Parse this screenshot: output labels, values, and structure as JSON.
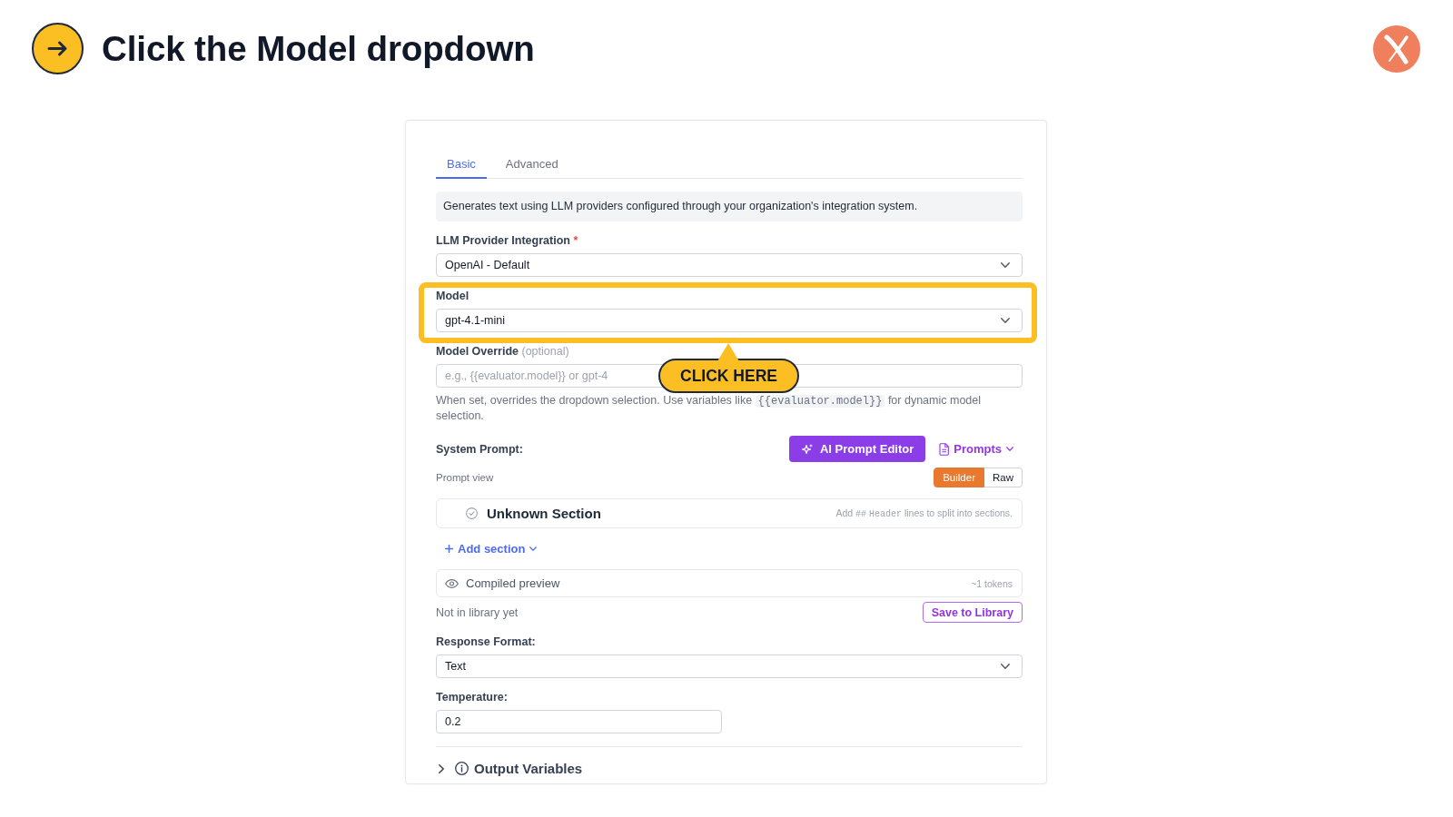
{
  "step": {
    "title": "Click the Model dropdown",
    "callout": "CLICK HERE"
  },
  "panel": {
    "tabs": [
      {
        "label": "Basic",
        "selected": true
      },
      {
        "label": "Advanced",
        "selected": false
      }
    ],
    "description": "Generates text using LLM providers configured through your organization's integration system.",
    "fields": [
      {
        "kind": "select",
        "label": "LLM Provider Integration",
        "required_mark": "*",
        "value": "OpenAI - Default",
        "highlighted": false
      },
      {
        "kind": "select",
        "label": "Model",
        "value": "gpt-4.1-mini",
        "highlighted": true
      },
      {
        "kind": "text",
        "label": "Model Override",
        "note": "(optional)",
        "placeholder": "e.g., {{evaluator.model}} or gpt-4",
        "highlighted": false,
        "help": [
          {
            "kind": "text",
            "text": "When set, overrides the dropdown selection. Use variables like"
          },
          {
            "kind": "code",
            "text": "{{evaluator.model}}"
          },
          {
            "kind": "text",
            "text": "for dynamic model selection."
          }
        ]
      }
    ],
    "system_prompt": {
      "label": "System Prompt:",
      "ai_button": "AI Prompt Editor",
      "prompts_menu": "Prompts",
      "view_label": "Prompt view",
      "view_options": [
        {
          "label": "Builder",
          "selected": true
        },
        {
          "label": "Raw",
          "selected": false
        }
      ],
      "sections": [
        {
          "title": "Unknown Section",
          "hint": [
            {
              "kind": "text",
              "text": "Add"
            },
            {
              "kind": "code",
              "text": "##"
            },
            {
              "kind": "code",
              "text": "Header"
            },
            {
              "kind": "text",
              "text": "lines to split into sections."
            }
          ]
        }
      ],
      "add_section": "Add section",
      "preview": {
        "label": "Compiled preview",
        "tokens": "~1 tokens"
      },
      "library_status": "Not in library yet",
      "save_button": "Save to Library"
    },
    "format_fields": [
      {
        "kind": "select",
        "label": "Response Format:",
        "value": "Text",
        "highlighted": false
      },
      {
        "kind": "number",
        "label": "Temperature:",
        "value": "0.2",
        "highlighted": false
      }
    ],
    "output_variables": {
      "label": "Output Variables",
      "expanded": false
    }
  }
}
